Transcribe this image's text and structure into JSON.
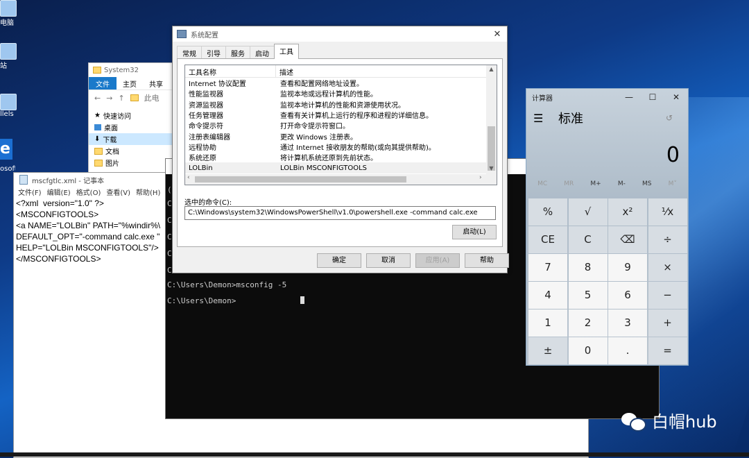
{
  "desktop": {
    "icons": [
      {
        "label": "电脑"
      },
      {
        "label": "站"
      },
      {
        "label": "llels re..."
      },
      {
        "label": "osoft ge"
      }
    ],
    "watermark": "白帽hub"
  },
  "explorer": {
    "path_hint": "System32",
    "ribbon": [
      "文件",
      "主页",
      "共享"
    ],
    "address": "此电",
    "tree": [
      "快速访问",
      "桌面",
      "下载",
      "文档",
      "图片"
    ]
  },
  "notepad": {
    "title": "mscfgtlc.xml - 记事本",
    "menu": [
      "文件(F)",
      "编辑(E)",
      "格式(O)",
      "查看(V)",
      "帮助(H)"
    ],
    "content": "<?xml  version=\"1.0\" ?>\n<MSCONFIGTOOLS>\n<a NAME=\"LOLBin\" PATH=\"%windir%\\\nDEFAULT_OPT=\"-command calc.exe \"\nHELP=\"LOLBin MSCONFIGTOOLS\"/>\n</MSCONFIGTOOLS>"
  },
  "cmd": {
    "lines": [
      "C:\\Users\\Demon>msconfig -5",
      "C:\\Users\\Demon>"
    ],
    "left_fragments": [
      "(",
      "C",
      "C",
      "C",
      "C",
      "C",
      "C"
    ]
  },
  "msconfig": {
    "title": "系统配置",
    "tabs": [
      "常规",
      "引导",
      "服务",
      "启动",
      "工具"
    ],
    "active_tab": "工具",
    "columns": [
      "工具名称",
      "描述"
    ],
    "rows": [
      {
        "name": "Internet 协议配置",
        "desc": "查看和配置网络地址设置。"
      },
      {
        "name": "性能监视器",
        "desc": "监视本地或远程计算机的性能。"
      },
      {
        "name": "资源监视器",
        "desc": "监视本地计算机的性能和资源使用状况。"
      },
      {
        "name": "任务管理器",
        "desc": "查看有关计算机上运行的程序和进程的详细信息。"
      },
      {
        "name": "命令提示符",
        "desc": "打开命令提示符窗口。"
      },
      {
        "name": "注册表编辑器",
        "desc": "更改 Windows 注册表。"
      },
      {
        "name": "远程协助",
        "desc": "通过 Internet 接收朋友的帮助(或向其提供帮助)。"
      },
      {
        "name": "系统还原",
        "desc": "将计算机系统还原到先前状态。"
      },
      {
        "name": "LOLBin",
        "desc": "LOLBin MSCONFIGTOOLS"
      }
    ],
    "selected_command_label": "选中的命令(C):",
    "selected_command": "C:\\Windows\\system32\\WindowsPowerShell\\v1.0\\powershell.exe -command calc.exe",
    "launch_button": "启动(L)",
    "buttons": {
      "ok": "确定",
      "cancel": "取消",
      "apply": "应用(A)",
      "help": "帮助"
    }
  },
  "calculator": {
    "title": "计算器",
    "mode": "标准",
    "display": "0",
    "memory": [
      "MC",
      "MR",
      "M+",
      "M-",
      "MS",
      "M˅"
    ],
    "keys": [
      "%",
      "√",
      "x²",
      "¹⁄x",
      "CE",
      "C",
      "⌫",
      "÷",
      "7",
      "8",
      "9",
      "×",
      "4",
      "5",
      "6",
      "−",
      "1",
      "2",
      "3",
      "+",
      "±",
      "0",
      ".",
      "="
    ]
  }
}
